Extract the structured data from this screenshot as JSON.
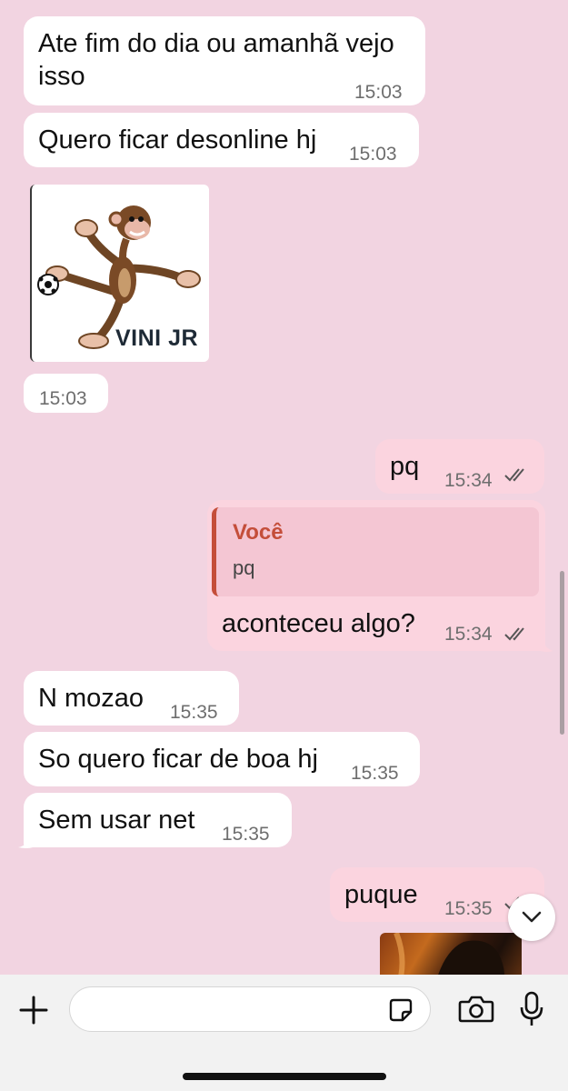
{
  "messages": [
    {
      "direction": "in",
      "lines": [
        "Ate fim do dia ou amanhã vejo",
        "isso"
      ],
      "time": "15:03"
    },
    {
      "direction": "in",
      "text": "Quero ficar desonline hj",
      "time": "15:03"
    },
    {
      "direction": "in",
      "type": "sticker",
      "caption": "VINI JR",
      "time": "15:03"
    },
    {
      "direction": "out",
      "text": "pq",
      "time": "15:34",
      "status": "read"
    },
    {
      "direction": "out",
      "reply": {
        "author": "Você",
        "text": "pq"
      },
      "text": "aconteceu algo?",
      "time": "15:34",
      "status": "read"
    },
    {
      "direction": "in",
      "text": "N mozao",
      "time": "15:35"
    },
    {
      "direction": "in",
      "text": "So quero ficar de boa hj",
      "time": "15:35"
    },
    {
      "direction": "in",
      "text": "Sem usar net",
      "time": "15:35"
    },
    {
      "direction": "out",
      "text": "puque",
      "time": "15:35",
      "status": "read"
    }
  ],
  "composer": {
    "value": "",
    "placeholder": "",
    "icons": [
      "plus-icon",
      "sticker-icon",
      "camera-icon",
      "microphone-icon"
    ]
  },
  "scroll_down_icon": "chevron-down-icon",
  "colors": {
    "background": "#f2d4e1",
    "incoming_bubble": "#ffffff",
    "outgoing_bubble": "#fbd4df",
    "reply_accent": "#c44e3a"
  }
}
